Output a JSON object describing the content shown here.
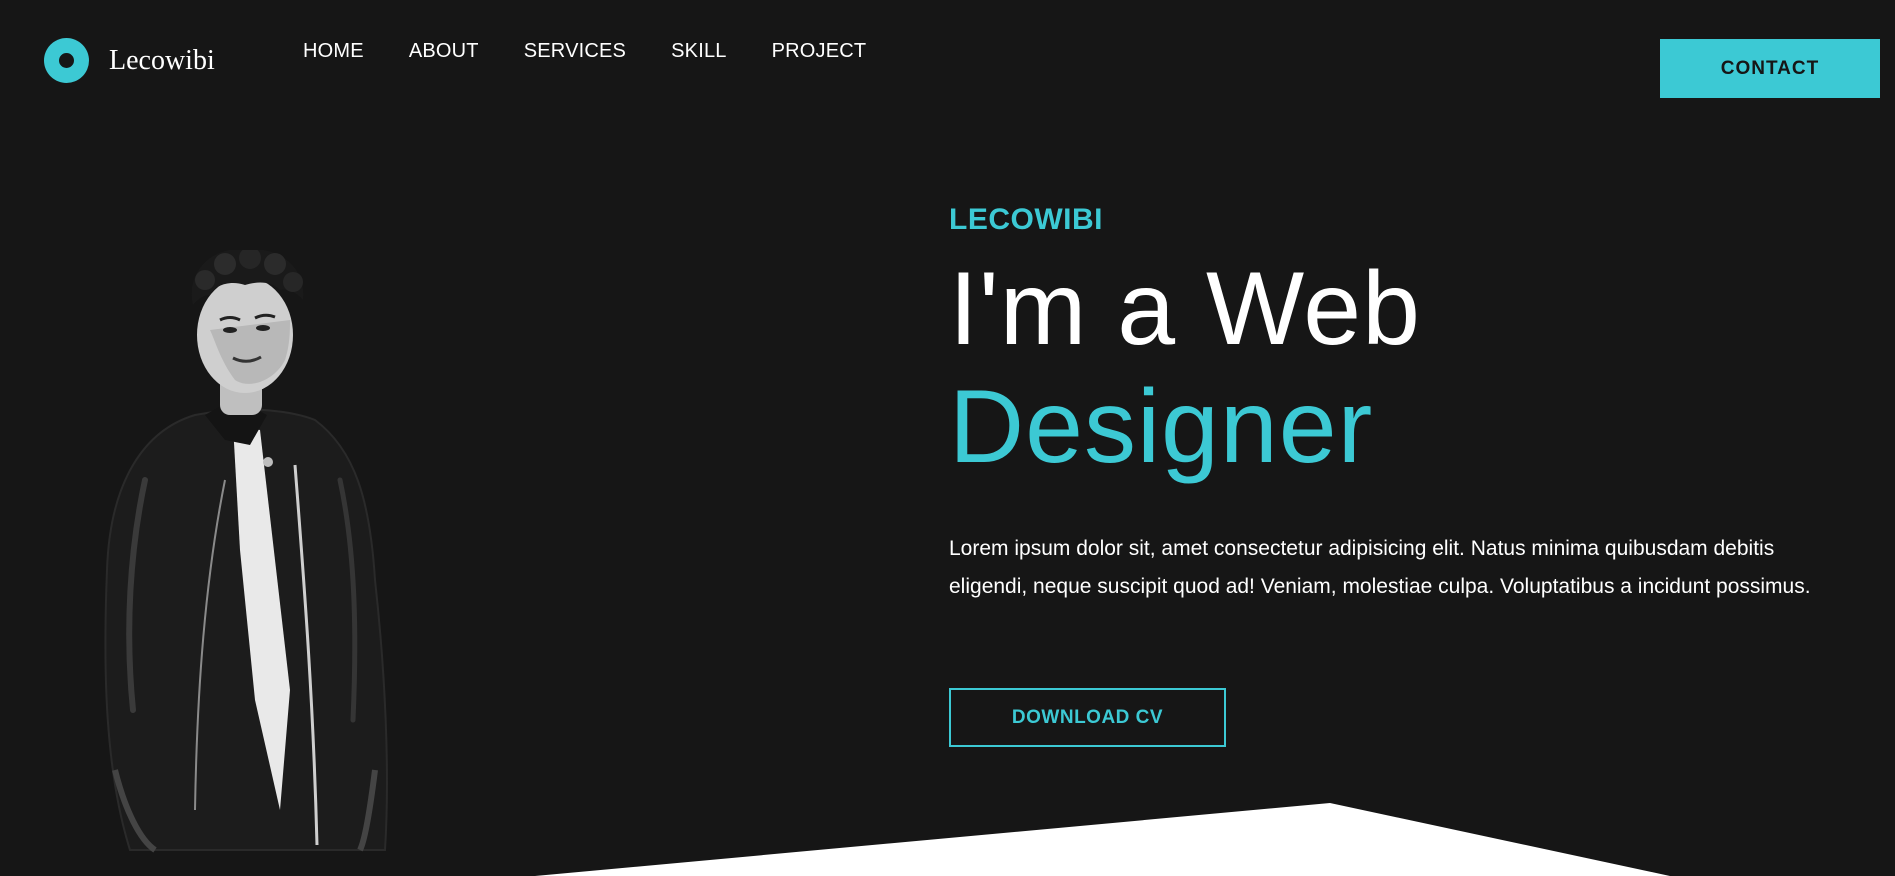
{
  "brand": {
    "name": "Lecowibi"
  },
  "nav": {
    "items": [
      {
        "label": "HOME"
      },
      {
        "label": "ABOUT"
      },
      {
        "label": "SERVICES"
      },
      {
        "label": "SKILL"
      },
      {
        "label": "PROJECT"
      }
    ]
  },
  "header": {
    "contact_label": "CONTACT"
  },
  "hero": {
    "eyebrow": "LECOWIBI",
    "headline_line1": "I'm a Web",
    "headline_line2": "Designer",
    "description": "Lorem ipsum dolor sit, amet consectetur adipisicing elit. Natus minima quibusdam debitis eligendi, neque suscipit quod ad! Veniam, molestiae culpa. Voluptatibus a incidunt possimus.",
    "download_label": "DOWNLOAD CV"
  },
  "colors": {
    "background": "#161616",
    "accent": "#3cc9d4",
    "text": "#ffffff"
  }
}
